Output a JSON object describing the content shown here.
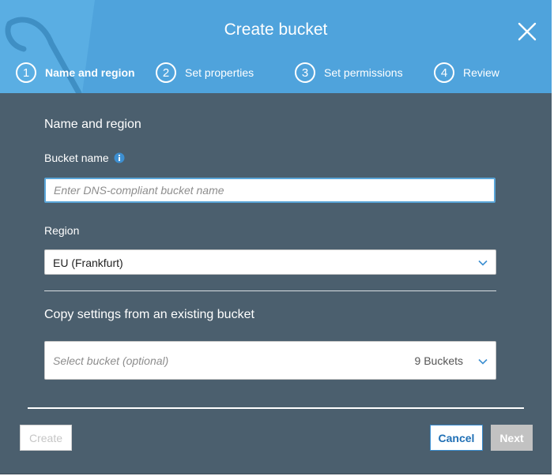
{
  "dialog": {
    "title": "Create bucket"
  },
  "steps": [
    {
      "number": "1",
      "label": "Name and region",
      "active": true
    },
    {
      "number": "2",
      "label": "Set properties",
      "active": false
    },
    {
      "number": "3",
      "label": "Set permissions",
      "active": false
    },
    {
      "number": "4",
      "label": "Review",
      "active": false
    }
  ],
  "name_region": {
    "section_title": "Name and region",
    "bucket_name_label": "Bucket name",
    "bucket_name_value": "",
    "bucket_name_placeholder": "Enter DNS-compliant bucket name",
    "region_label": "Region",
    "region_value": "EU (Frankfurt)"
  },
  "copy_settings": {
    "section_title": "Copy settings from an existing bucket",
    "select_placeholder": "Select bucket (optional)",
    "bucket_count": "9 Buckets"
  },
  "footer": {
    "create_label": "Create",
    "cancel_label": "Cancel",
    "next_label": "Next"
  },
  "icons": {
    "close": "close-icon",
    "info": "info-icon",
    "dropdown": "chevron-down-icon"
  },
  "colors": {
    "header_bg": "#4fa3dc",
    "body_bg": "#4b5f6e",
    "accent": "#1f6fb5",
    "disabled": "#c2c2c2"
  }
}
